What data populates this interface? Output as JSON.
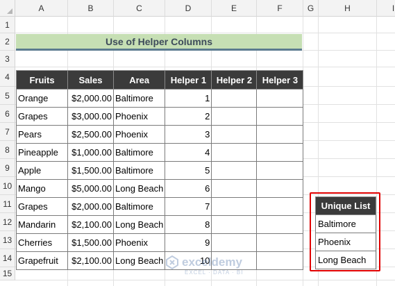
{
  "spreadsheet": {
    "columns": [
      "A",
      "B",
      "C",
      "D",
      "E",
      "F",
      "G",
      "H",
      "I"
    ],
    "rows": [
      "1",
      "2",
      "3",
      "4",
      "5",
      "6",
      "7",
      "8",
      "9",
      "10",
      "11",
      "12",
      "13",
      "14",
      "15"
    ]
  },
  "title": "Use of Helper Columns",
  "table": {
    "headers": [
      "Fruits",
      "Sales",
      "Area",
      "Helper 1",
      "Helper 2",
      "Helper 3"
    ],
    "rows": [
      {
        "fruit": "Orange",
        "sales": "$2,000.00",
        "area": "Baltimore",
        "helper1": "1"
      },
      {
        "fruit": "Grapes",
        "sales": "$3,000.00",
        "area": "Phoenix",
        "helper1": "2"
      },
      {
        "fruit": "Pears",
        "sales": "$2,500.00",
        "area": "Phoenix",
        "helper1": "3"
      },
      {
        "fruit": "Pineapple",
        "sales": "$1,000.00",
        "area": "Baltimore",
        "helper1": "4"
      },
      {
        "fruit": "Apple",
        "sales": "$1,500.00",
        "area": "Baltimore",
        "helper1": "5"
      },
      {
        "fruit": "Mango",
        "sales": "$5,000.00",
        "area": "Long Beach",
        "helper1": "6"
      },
      {
        "fruit": "Grapes",
        "sales": "$2,000.00",
        "area": "Baltimore",
        "helper1": "7"
      },
      {
        "fruit": "Mandarin",
        "sales": "$2,100.00",
        "area": "Long Beach",
        "helper1": "8"
      },
      {
        "fruit": "Cherries",
        "sales": "$1,500.00",
        "area": "Phoenix",
        "helper1": "9"
      },
      {
        "fruit": "Grapefruit",
        "sales": "$2,100.00",
        "area": "Long Beach",
        "helper1": "10"
      }
    ]
  },
  "unique_list": {
    "header": "Unique List",
    "items": [
      "Baltimore",
      "Phoenix",
      "Long Beach"
    ],
    "highlight_color": "#e00000"
  },
  "watermark": {
    "brand": "exceldemy",
    "tagline": "EXCEL · DATA · BI"
  }
}
